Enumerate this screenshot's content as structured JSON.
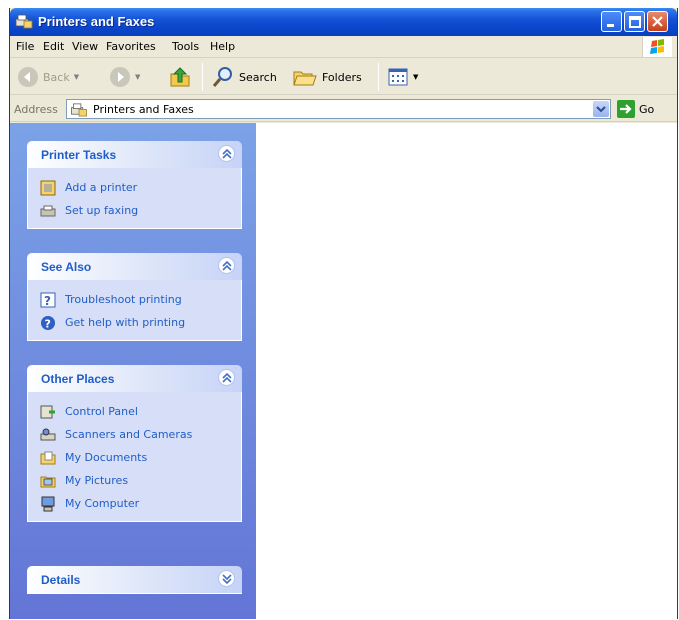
{
  "window": {
    "title": "Printers and Faxes"
  },
  "menu": {
    "items": [
      "File",
      "Edit",
      "View",
      "Favorites",
      "Tools",
      "Help"
    ]
  },
  "toolbar": {
    "back": "Back",
    "search": "Search",
    "folders": "Folders"
  },
  "address": {
    "label": "Address",
    "value": "Printers and Faxes",
    "go": "Go"
  },
  "tasks": {
    "printer_tasks": {
      "title": "Printer Tasks",
      "items": [
        "Add a printer",
        "Set up faxing"
      ]
    },
    "see_also": {
      "title": "See Also",
      "items": [
        "Troubleshoot printing",
        "Get help with printing"
      ]
    },
    "other_places": {
      "title": "Other Places",
      "items": [
        "Control Panel",
        "Scanners and Cameras",
        "My Documents",
        "My Pictures",
        "My Computer"
      ]
    },
    "details": {
      "title": "Details"
    }
  },
  "colors": {
    "titlebar": "#0b46cb",
    "taskpane": "#7ba2e7",
    "link": "#215dc6"
  }
}
